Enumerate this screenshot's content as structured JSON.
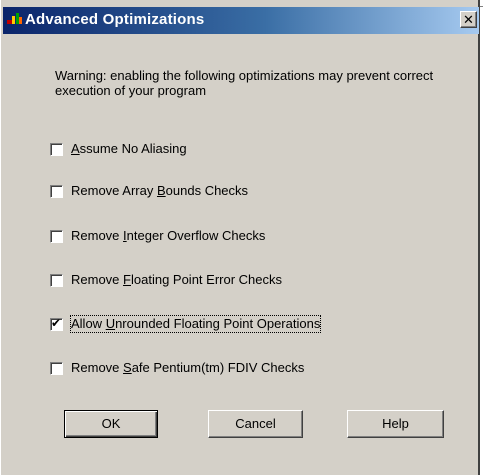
{
  "window": {
    "title": "Advanced Optimizations",
    "close_glyph": "✕"
  },
  "warning": "Warning: enabling the following optimizations may prevent correct execution of your program",
  "options": [
    {
      "pre": "",
      "key": "A",
      "post": "ssume No Aliasing",
      "checked": false
    },
    {
      "pre": "Remove Array ",
      "key": "B",
      "post": "ounds Checks",
      "checked": false
    },
    {
      "pre": "Remove ",
      "key": "I",
      "post": "nteger Overflow Checks",
      "checked": false
    },
    {
      "pre": "Remove ",
      "key": "F",
      "post": "loating Point Error Checks",
      "checked": false
    },
    {
      "pre": "Allow ",
      "key": "U",
      "post": "nrounded Floating Point Operations",
      "checked": true
    },
    {
      "pre": "Remove ",
      "key": "S",
      "post": "afe Pentium(tm) FDIV Checks",
      "checked": false
    }
  ],
  "check_glyph": "✔",
  "buttons": {
    "ok": "OK",
    "cancel": "Cancel",
    "help": "Help"
  },
  "colors": {
    "title_start": "#0a246a",
    "title_end": "#a6caf0",
    "face": "#d4d0c8"
  },
  "icons": {
    "app": "app-icon",
    "close": "close-icon"
  }
}
